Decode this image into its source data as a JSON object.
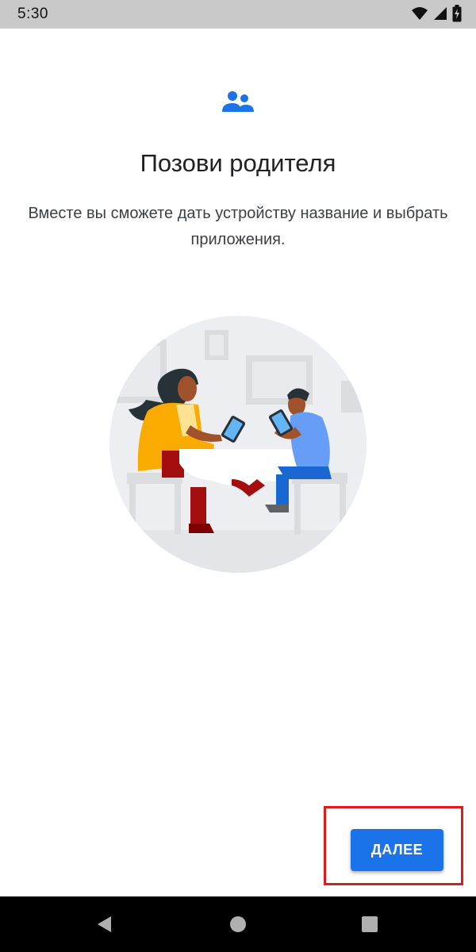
{
  "status_bar": {
    "time": "5:30",
    "icons": [
      "wifi-icon",
      "cellular-signal-icon",
      "battery-charging-icon"
    ]
  },
  "header": {
    "icon": "family-people-icon",
    "title": "Позови родителя",
    "subtitle": "Вместе вы сможете дать устройству название и выбрать приложения."
  },
  "illustration": {
    "description_icon": "parent-and-child-at-table-illustration"
  },
  "actions": {
    "next_label": "ДАЛЕЕ"
  },
  "nav_bar": {
    "buttons": [
      "back-icon",
      "home-icon",
      "recents-icon"
    ]
  },
  "colors": {
    "accent": "#1a73e8",
    "highlight": "#e01b1b",
    "status_bar": "#c9c9c9",
    "nav_bar": "#000000"
  }
}
